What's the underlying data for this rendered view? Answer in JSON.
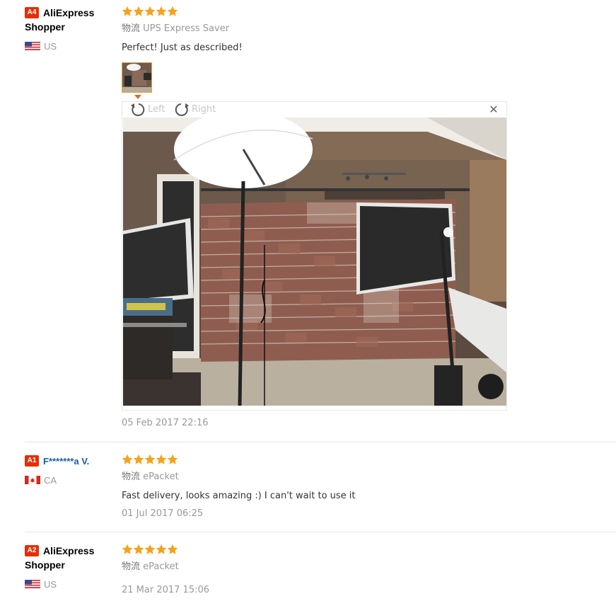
{
  "reviews": [
    {
      "badge": "A4",
      "user_line1": "AliExpress",
      "user_line2": "Shopper",
      "country": "US",
      "rating": 5,
      "shipping_label": "物流",
      "shipping_method": "UPS Express Saver",
      "feedback": "Perfect! Just as described!",
      "date": "05 Feb 2017 22:16",
      "has_photo": true
    },
    {
      "badge": "A1",
      "user_line1": "F*******a V.",
      "country": "CA",
      "rating": 5,
      "shipping_label": "物流",
      "shipping_method": "ePacket",
      "feedback": "Fast delivery, looks amazing :) I can't wait to use it",
      "date": "01 Jul 2017 06:25"
    },
    {
      "badge": "A2",
      "user_line1": "AliExpress",
      "user_line2": "Shopper",
      "country": "US",
      "rating": 5,
      "shipping_label": "物流",
      "shipping_method": "ePacket",
      "date": "21 Mar 2017 15:06"
    }
  ],
  "viewer": {
    "rotate_left_label": "Left",
    "rotate_right_label": "Right",
    "close_icon": "close-icon"
  },
  "colors": {
    "badge": "#e62e04",
    "star": "#f7a21b",
    "link": "#1a5ca8",
    "muted": "#999999"
  }
}
